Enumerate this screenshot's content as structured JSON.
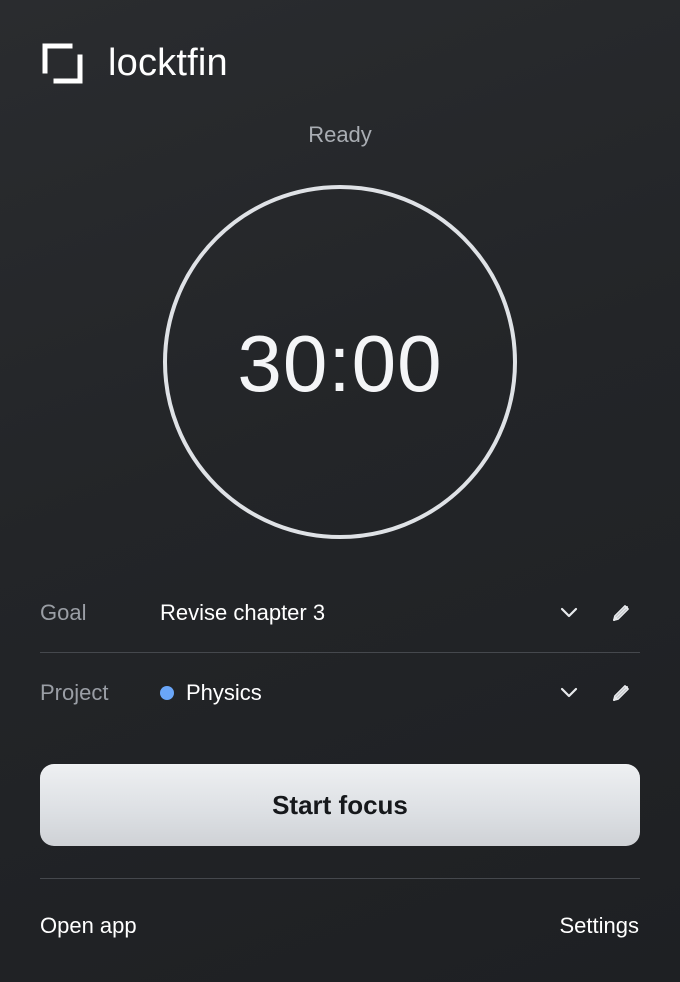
{
  "brand": {
    "name": "locktfin",
    "logo_icon": "bracket-frame-icon"
  },
  "timer": {
    "status": "Ready",
    "time": "30:00"
  },
  "fields": {
    "goal": {
      "label": "Goal",
      "value": "Revise chapter 3",
      "icons": [
        "chevron-down-icon",
        "pencil-icon"
      ]
    },
    "project": {
      "label": "Project",
      "value": "Physics",
      "dot_color": "#6aa6f8",
      "icons": [
        "chevron-down-icon",
        "pencil-icon"
      ]
    }
  },
  "actions": {
    "start_label": "Start focus",
    "open_app_label": "Open app",
    "settings_label": "Settings"
  },
  "colors": {
    "background": "#232528",
    "ring": "#dfe2e6",
    "button": "#dcdfe3",
    "label": "#9a9ea5"
  }
}
